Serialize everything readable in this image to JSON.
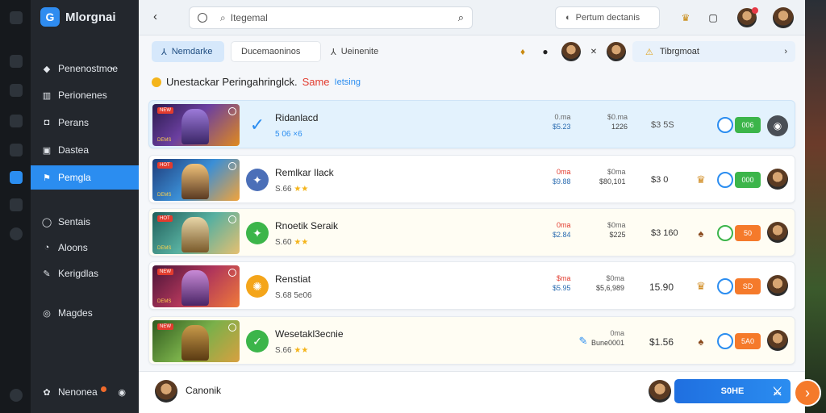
{
  "app": {
    "name": "Mlorgnai",
    "logo_glyph": "G"
  },
  "sidebar": {
    "items": [
      {
        "label": "Penenostmoe",
        "icon": "diamond-icon",
        "glyph": "◆",
        "marker": "•"
      },
      {
        "label": "Perionenes",
        "icon": "chart-icon",
        "glyph": "▥"
      },
      {
        "label": "Perans",
        "icon": "square-icon",
        "glyph": "◘"
      },
      {
        "label": "Dastea",
        "icon": "image-icon",
        "glyph": "▣"
      },
      {
        "label": "Pemgla",
        "icon": "flag-icon",
        "glyph": "⚑",
        "active": true
      },
      {
        "label": "Sentais",
        "icon": "chat-icon",
        "glyph": "◯"
      },
      {
        "label": "Aloons",
        "icon": "user-icon",
        "glyph": "◔"
      },
      {
        "label": "Kerigdlas",
        "icon": "pin-icon",
        "glyph": "✎"
      },
      {
        "label": "Magdes",
        "icon": "compass-icon",
        "glyph": "◎"
      }
    ],
    "footer": {
      "label": "Nenonea",
      "icon": "gear-icon",
      "glyph": "✿",
      "right_glyph": "◉"
    }
  },
  "topbar": {
    "back_glyph": "‹",
    "search_placeholder": "Itegemal",
    "search_glyph": "⌕",
    "pill_label": "Pertum dectanis",
    "pill_glyph": "◐",
    "icons": [
      {
        "name": "trophy-icon",
        "glyph": "♛",
        "color": "#c98a12"
      },
      {
        "name": "square-icon",
        "glyph": "▢",
        "color": "#222222"
      }
    ]
  },
  "tabs": [
    {
      "label": "Nemdarke",
      "glyph": "⅄",
      "active": true
    },
    {
      "label": "Ducemaoninos",
      "glyph": "",
      "active": false
    },
    {
      "label": "Ueinenite",
      "glyph": "⅄",
      "active": false
    }
  ],
  "tab_icons": {
    "bell_glyph": "♦",
    "pin_glyph": "●",
    "x_glyph": "✕"
  },
  "alert": {
    "label": "Tibrgmoat",
    "glyph": "⚠",
    "chevron": "›"
  },
  "section": {
    "title": "Unestackar Peringahringlck.",
    "highlight": "Same",
    "sub": "Ietsing"
  },
  "games": [
    {
      "name": "Ridanlacd",
      "sub": "5 06 ×6",
      "stars": "",
      "thumb_tag": "NEW",
      "thumb_cap": "DEMS",
      "col1_top": "0.ma",
      "col1_bot": "$5.23",
      "col2_top": "$0.ma",
      "col2_bot": "1226",
      "price": "$3 5S",
      "price_red": "$3",
      "btn": "006",
      "btn_color": "green",
      "icon_color": "#2b8df0",
      "icon_glyph": "✓"
    },
    {
      "name": "Remlkar Ilack",
      "sub": "S.66",
      "stars": "★★",
      "thumb_tag": "HOT",
      "thumb_cap": "DEMS",
      "col1_top": "0ma",
      "col1_bot": "$9.88",
      "col2_top": "$0ma",
      "col2_bot": "$80,101",
      "price": "$3 0",
      "price_red": "$3",
      "btn": "000",
      "btn_color": "green",
      "icon_color": "#e08a1e",
      "icon_glyph": "✦"
    },
    {
      "name": "Rnoetik Seraik",
      "sub": "S.60",
      "stars": "★★",
      "thumb_tag": "HOT",
      "thumb_cap": "DEMS",
      "col1_top": "0ma",
      "col1_bot": "$2.84",
      "col2_top": "$0ma",
      "col2_bot": "$225",
      "price": "$3 160",
      "price_red": "$3",
      "btn": "50",
      "btn_color": "orange",
      "icon_color": "#3cb54a",
      "icon_glyph": "✦"
    },
    {
      "name": "Renstiat",
      "sub": "S.68 5e06",
      "stars": "",
      "thumb_tag": "NEW",
      "thumb_cap": "DEMS",
      "col1_top": "$ma",
      "col1_bot": "$5.95",
      "col2_top": "$0ma",
      "col2_bot": "$5,6,989",
      "price": "15.90",
      "price_red": "",
      "btn": "SD",
      "btn_color": "orange",
      "icon_color": "#f4a51a",
      "icon_glyph": "✺"
    },
    {
      "name": "Wesetakl3ecnie",
      "sub": "S.66",
      "stars": "★★",
      "thumb_tag": "NEW",
      "thumb_cap": "",
      "col1_top": "",
      "col1_bot": "",
      "col2_top": "0ma",
      "col2_bot": "Bune0001",
      "price": "$1.56",
      "price_red": "",
      "btn": "5A0",
      "btn_color": "orange",
      "icon_color": "#3cb54a",
      "icon_glyph": "✓"
    }
  ],
  "footer": {
    "name": "Canonik",
    "cta_label": "S0HE",
    "cta_glyph": "⚔",
    "fab_glyph": "›"
  },
  "colors": {
    "accent": "#2b8df0",
    "sidebar_bg": "#23272d",
    "highlight_row": "#e3f2fd",
    "danger": "#e23b2e",
    "orange": "#f57a2b",
    "green": "#3cb54a"
  }
}
